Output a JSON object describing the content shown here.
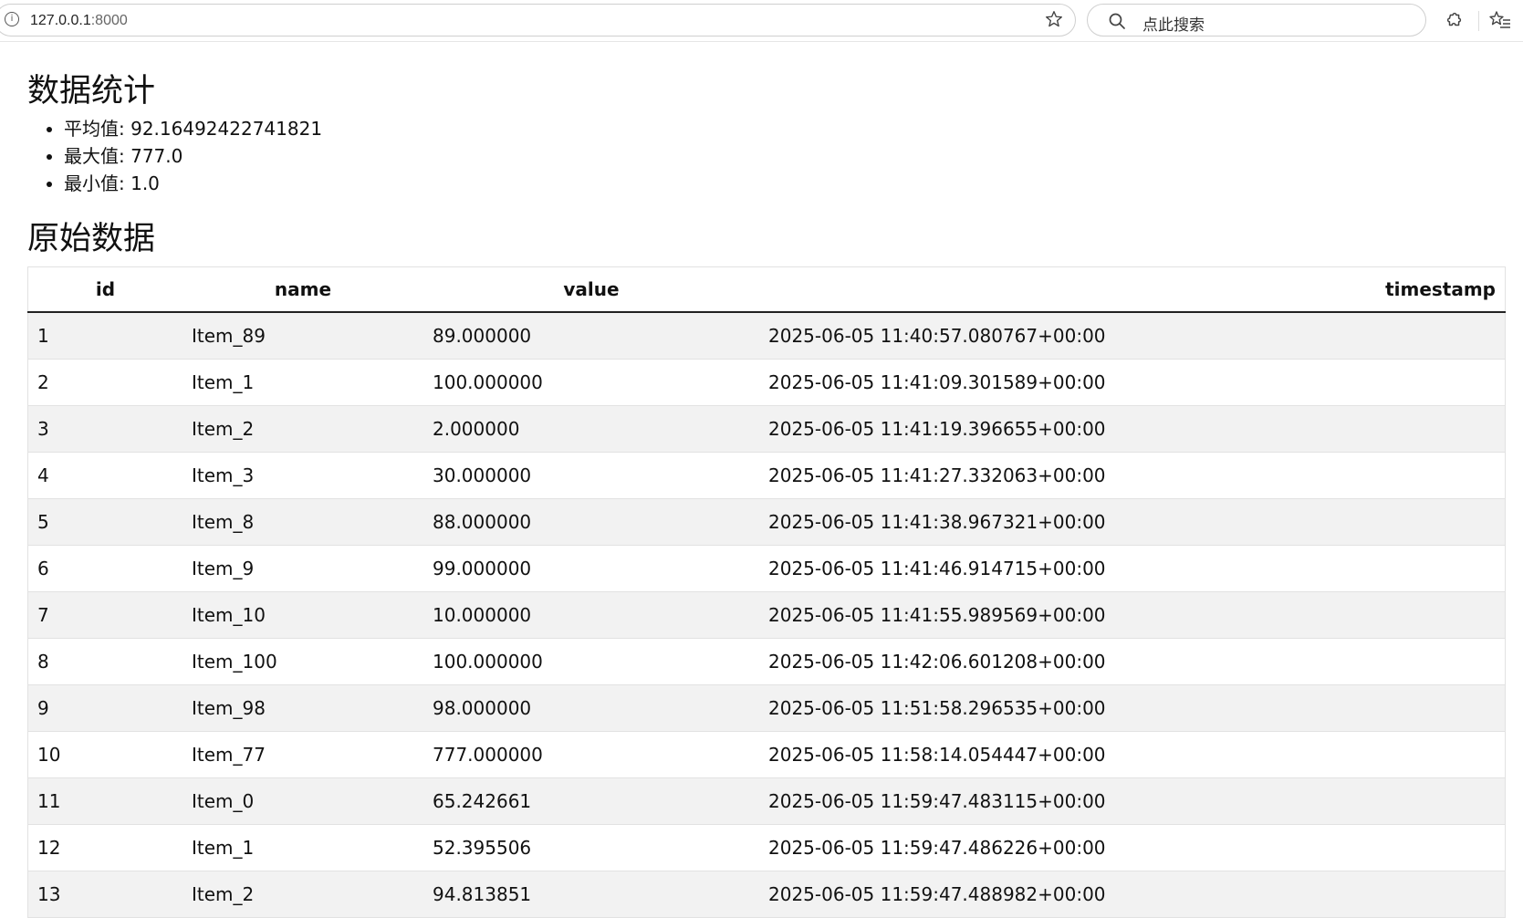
{
  "browser": {
    "url_host": "127.0.0.1",
    "url_port": ":8000",
    "search_placeholder": "点此搜索"
  },
  "stats": {
    "title": "数据统计",
    "items": [
      {
        "label": "平均值: 92.16492422741821"
      },
      {
        "label": "最大值: 777.0"
      },
      {
        "label": "最小值: 1.0"
      }
    ]
  },
  "raw": {
    "title": "原始数据",
    "columns": [
      "id",
      "name",
      "value",
      "timestamp"
    ],
    "rows": [
      [
        "1",
        "Item_89",
        "89.000000",
        "2025-06-05 11:40:57.080767+00:00"
      ],
      [
        "2",
        "Item_1",
        "100.000000",
        "2025-06-05 11:41:09.301589+00:00"
      ],
      [
        "3",
        "Item_2",
        "2.000000",
        "2025-06-05 11:41:19.396655+00:00"
      ],
      [
        "4",
        "Item_3",
        "30.000000",
        "2025-06-05 11:41:27.332063+00:00"
      ],
      [
        "5",
        "Item_8",
        "88.000000",
        "2025-06-05 11:41:38.967321+00:00"
      ],
      [
        "6",
        "Item_9",
        "99.000000",
        "2025-06-05 11:41:46.914715+00:00"
      ],
      [
        "7",
        "Item_10",
        "10.000000",
        "2025-06-05 11:41:55.989569+00:00"
      ],
      [
        "8",
        "Item_100",
        "100.000000",
        "2025-06-05 11:42:06.601208+00:00"
      ],
      [
        "9",
        "Item_98",
        "98.000000",
        "2025-06-05 11:51:58.296535+00:00"
      ],
      [
        "10",
        "Item_77",
        "777.000000",
        "2025-06-05 11:58:14.054447+00:00"
      ],
      [
        "11",
        "Item_0",
        "65.242661",
        "2025-06-05 11:59:47.483115+00:00"
      ],
      [
        "12",
        "Item_1",
        "52.395506",
        "2025-06-05 11:59:47.486226+00:00"
      ],
      [
        "13",
        "Item_2",
        "94.813851",
        "2025-06-05 11:59:47.488982+00:00"
      ]
    ]
  }
}
